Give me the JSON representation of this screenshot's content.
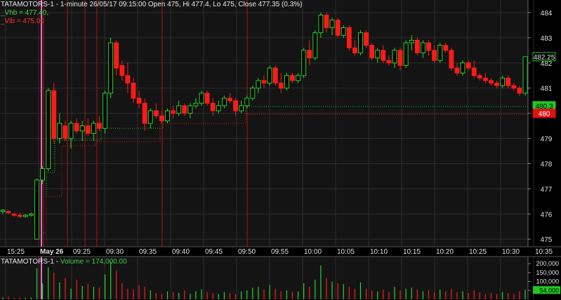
{
  "header": {
    "title": "TATAMOTORS-1 - 1-minute 26/05/17 09:15:00 Open 475, Hi 477.4, Lo 475, Close 477.35 (0.3%)",
    "vhb_label": "_Vhb = 477.40,",
    "vlb_label": "_Vlb = 475.00"
  },
  "volume_header": {
    "prefix": "TATAMOTORS-1 - ",
    "label": "Volume = 174,000.00"
  },
  "colors": {
    "up": "#29d429",
    "down": "#ff1a1a",
    "grid": "#2c2c2c",
    "text": "#e0e0e0",
    "pink": "#ff66cc"
  },
  "chart_data": [
    {
      "type": "candlestick",
      "title": "TATAMOTORS-1 - 1-minute",
      "ylim": [
        474.7,
        484.5
      ],
      "y_ticks": [
        475,
        476,
        477,
        478,
        479,
        480,
        481,
        482,
        483,
        484
      ],
      "x_labels": [
        "15:25",
        "May 26",
        "09:25",
        "09:30",
        "09:35",
        "09:40",
        "09:45",
        "09:50",
        "09:55",
        "10:00",
        "10:05",
        "10:10",
        "10:15",
        "10:20",
        "10:25",
        "10:30",
        "10:35"
      ],
      "price_markers": [
        {
          "value": 482.25,
          "label": "482.25",
          "color": "green"
        },
        {
          "value": 480.3,
          "label": "480.3",
          "color": "green"
        },
        {
          "value": 480.0,
          "label": "480",
          "color": "red"
        }
      ],
      "candles": [
        {
          "o": 476.1,
          "h": 476.2,
          "l": 476.0,
          "c": 476.15
        },
        {
          "o": 476.1,
          "h": 476.15,
          "l": 476.0,
          "c": 476.05
        },
        {
          "o": 476.0,
          "h": 476.05,
          "l": 475.9,
          "c": 475.95
        },
        {
          "o": 475.95,
          "h": 476.05,
          "l": 475.85,
          "c": 475.9
        },
        {
          "o": 475.9,
          "h": 476.0,
          "l": 475.85,
          "c": 475.95
        },
        {
          "o": 475.95,
          "h": 476.05,
          "l": 475.9,
          "c": 476.0
        },
        {
          "o": 475.0,
          "h": 477.4,
          "l": 475.0,
          "c": 477.35
        },
        {
          "o": 477.35,
          "h": 477.9,
          "l": 477.2,
          "c": 477.8
        },
        {
          "o": 477.8,
          "h": 481.0,
          "l": 477.7,
          "c": 480.9
        },
        {
          "o": 480.9,
          "h": 481.2,
          "l": 478.8,
          "c": 479.0
        },
        {
          "o": 479.0,
          "h": 480.0,
          "l": 478.8,
          "c": 479.6
        },
        {
          "o": 479.5,
          "h": 479.7,
          "l": 478.9,
          "c": 479.0
        },
        {
          "o": 479.0,
          "h": 479.7,
          "l": 478.6,
          "c": 479.6
        },
        {
          "o": 479.6,
          "h": 479.8,
          "l": 479.2,
          "c": 479.3
        },
        {
          "o": 479.3,
          "h": 479.7,
          "l": 478.9,
          "c": 479.5
        },
        {
          "o": 479.5,
          "h": 479.8,
          "l": 479.1,
          "c": 479.2
        },
        {
          "o": 479.2,
          "h": 479.7,
          "l": 478.9,
          "c": 479.6
        },
        {
          "o": 479.6,
          "h": 479.9,
          "l": 479.3,
          "c": 479.4
        },
        {
          "o": 479.4,
          "h": 480.9,
          "l": 479.2,
          "c": 480.8
        },
        {
          "o": 480.8,
          "h": 483.0,
          "l": 480.6,
          "c": 482.8
        },
        {
          "o": 482.8,
          "h": 482.9,
          "l": 481.5,
          "c": 481.8
        },
        {
          "o": 481.9,
          "h": 482.1,
          "l": 481.3,
          "c": 481.5
        },
        {
          "o": 481.5,
          "h": 482.0,
          "l": 480.8,
          "c": 481.2
        },
        {
          "o": 481.2,
          "h": 481.4,
          "l": 480.4,
          "c": 480.6
        },
        {
          "o": 480.6,
          "h": 480.9,
          "l": 480.2,
          "c": 480.4
        },
        {
          "o": 480.4,
          "h": 480.6,
          "l": 479.3,
          "c": 479.6
        },
        {
          "o": 479.6,
          "h": 480.2,
          "l": 479.4,
          "c": 480.1
        },
        {
          "o": 480.1,
          "h": 480.4,
          "l": 479.8,
          "c": 479.9
        },
        {
          "o": 479.9,
          "h": 480.1,
          "l": 479.6,
          "c": 479.7
        },
        {
          "o": 479.7,
          "h": 480.2,
          "l": 479.6,
          "c": 480.1
        },
        {
          "o": 480.1,
          "h": 480.3,
          "l": 479.8,
          "c": 480.0
        },
        {
          "o": 480.0,
          "h": 480.5,
          "l": 479.9,
          "c": 480.3
        },
        {
          "o": 480.3,
          "h": 480.4,
          "l": 479.9,
          "c": 480.0
        },
        {
          "o": 480.0,
          "h": 480.4,
          "l": 479.8,
          "c": 480.3
        },
        {
          "o": 480.3,
          "h": 480.6,
          "l": 480.2,
          "c": 480.4
        },
        {
          "o": 480.4,
          "h": 480.9,
          "l": 480.3,
          "c": 480.8
        },
        {
          "o": 480.8,
          "h": 480.9,
          "l": 480.3,
          "c": 480.4
        },
        {
          "o": 480.4,
          "h": 480.6,
          "l": 479.9,
          "c": 480.1
        },
        {
          "o": 480.1,
          "h": 480.5,
          "l": 480.0,
          "c": 480.3
        },
        {
          "o": 480.3,
          "h": 480.7,
          "l": 480.2,
          "c": 480.6
        },
        {
          "o": 480.6,
          "h": 480.8,
          "l": 480.4,
          "c": 480.5
        },
        {
          "o": 480.5,
          "h": 480.6,
          "l": 479.9,
          "c": 480.1
        },
        {
          "o": 480.1,
          "h": 480.5,
          "l": 480.0,
          "c": 480.3
        },
        {
          "o": 480.3,
          "h": 480.7,
          "l": 480.2,
          "c": 480.6
        },
        {
          "o": 480.6,
          "h": 481.1,
          "l": 480.5,
          "c": 481.0
        },
        {
          "o": 481.0,
          "h": 481.4,
          "l": 480.8,
          "c": 481.3
        },
        {
          "o": 481.3,
          "h": 481.5,
          "l": 481.0,
          "c": 481.2
        },
        {
          "o": 481.2,
          "h": 481.9,
          "l": 481.1,
          "c": 481.8
        },
        {
          "o": 481.8,
          "h": 481.9,
          "l": 481.1,
          "c": 481.2
        },
        {
          "o": 481.2,
          "h": 481.6,
          "l": 480.8,
          "c": 481.0
        },
        {
          "o": 481.0,
          "h": 481.6,
          "l": 480.9,
          "c": 481.5
        },
        {
          "o": 481.5,
          "h": 481.6,
          "l": 481.2,
          "c": 481.3
        },
        {
          "o": 481.3,
          "h": 481.6,
          "l": 481.2,
          "c": 481.5
        },
        {
          "o": 481.5,
          "h": 482.6,
          "l": 481.4,
          "c": 482.5
        },
        {
          "o": 482.5,
          "h": 482.9,
          "l": 481.9,
          "c": 482.2
        },
        {
          "o": 482.2,
          "h": 483.3,
          "l": 482.1,
          "c": 483.2
        },
        {
          "o": 483.2,
          "h": 484.0,
          "l": 483.0,
          "c": 483.9
        },
        {
          "o": 483.9,
          "h": 484.0,
          "l": 483.2,
          "c": 483.4
        },
        {
          "o": 483.4,
          "h": 483.8,
          "l": 483.1,
          "c": 483.7
        },
        {
          "o": 483.7,
          "h": 483.8,
          "l": 483.0,
          "c": 483.1
        },
        {
          "o": 483.1,
          "h": 483.5,
          "l": 483.0,
          "c": 483.4
        },
        {
          "o": 483.4,
          "h": 483.5,
          "l": 482.5,
          "c": 482.6
        },
        {
          "o": 482.6,
          "h": 482.9,
          "l": 482.3,
          "c": 482.4
        },
        {
          "o": 482.4,
          "h": 483.3,
          "l": 482.3,
          "c": 483.2
        },
        {
          "o": 483.2,
          "h": 483.3,
          "l": 482.6,
          "c": 482.7
        },
        {
          "o": 482.7,
          "h": 482.8,
          "l": 482.1,
          "c": 482.2
        },
        {
          "o": 482.2,
          "h": 482.6,
          "l": 482.0,
          "c": 482.5
        },
        {
          "o": 482.5,
          "h": 482.7,
          "l": 482.0,
          "c": 482.1
        },
        {
          "o": 482.1,
          "h": 482.3,
          "l": 481.9,
          "c": 482.0
        },
        {
          "o": 482.0,
          "h": 482.6,
          "l": 481.8,
          "c": 482.5
        },
        {
          "o": 482.5,
          "h": 482.6,
          "l": 481.7,
          "c": 481.9
        },
        {
          "o": 481.9,
          "h": 482.9,
          "l": 481.8,
          "c": 482.8
        },
        {
          "o": 482.8,
          "h": 483.1,
          "l": 482.5,
          "c": 482.9
        },
        {
          "o": 482.9,
          "h": 483.0,
          "l": 482.3,
          "c": 482.4
        },
        {
          "o": 482.4,
          "h": 482.9,
          "l": 482.2,
          "c": 482.8
        },
        {
          "o": 482.8,
          "h": 482.9,
          "l": 482.3,
          "c": 482.5
        },
        {
          "o": 482.5,
          "h": 482.7,
          "l": 482.0,
          "c": 482.1
        },
        {
          "o": 482.1,
          "h": 482.8,
          "l": 482.0,
          "c": 482.7
        },
        {
          "o": 482.7,
          "h": 482.8,
          "l": 482.4,
          "c": 482.5
        },
        {
          "o": 482.5,
          "h": 482.6,
          "l": 481.7,
          "c": 481.8
        },
        {
          "o": 481.8,
          "h": 482.0,
          "l": 481.5,
          "c": 481.6
        },
        {
          "o": 481.6,
          "h": 482.1,
          "l": 481.5,
          "c": 482.0
        },
        {
          "o": 482.0,
          "h": 482.1,
          "l": 481.7,
          "c": 481.8
        },
        {
          "o": 481.8,
          "h": 482.1,
          "l": 481.4,
          "c": 481.5
        },
        {
          "o": 481.5,
          "h": 481.6,
          "l": 481.3,
          "c": 481.4
        },
        {
          "o": 481.4,
          "h": 481.6,
          "l": 481.2,
          "c": 481.3
        },
        {
          "o": 481.3,
          "h": 481.4,
          "l": 481.1,
          "c": 481.2
        },
        {
          "o": 481.2,
          "h": 481.3,
          "l": 481.0,
          "c": 481.1
        },
        {
          "o": 481.1,
          "h": 481.5,
          "l": 481.0,
          "c": 481.4
        },
        {
          "o": 481.4,
          "h": 481.5,
          "l": 481.0,
          "c": 481.1
        },
        {
          "o": 481.1,
          "h": 481.2,
          "l": 480.9,
          "c": 481.0
        },
        {
          "o": 481.0,
          "h": 481.1,
          "l": 480.7,
          "c": 480.8
        },
        {
          "o": 480.8,
          "h": 482.25,
          "l": 480.7,
          "c": 482.25
        }
      ]
    },
    {
      "type": "bar",
      "title": "Volume",
      "y_ticks": [
        50000,
        100000,
        150000,
        200000
      ],
      "y_tick_labels": [
        "50,000",
        "100,000",
        "150,000",
        "200,000"
      ],
      "last_value_label": "54,000",
      "ylim": [
        0,
        240000
      ],
      "values": [
        12000,
        15000,
        9000,
        11000,
        8000,
        10000,
        174000,
        90000,
        180000,
        150000,
        95000,
        120000,
        60000,
        110000,
        75000,
        85000,
        70000,
        65000,
        140000,
        210000,
        160000,
        90000,
        60000,
        55000,
        80000,
        70000,
        50000,
        35000,
        30000,
        45000,
        40000,
        35000,
        50000,
        30000,
        45000,
        55000,
        40000,
        35000,
        30000,
        40000,
        35000,
        30000,
        45000,
        50000,
        65000,
        70000,
        55000,
        80000,
        60000,
        45000,
        50000,
        40000,
        45000,
        90000,
        70000,
        110000,
        190000,
        120000,
        100000,
        90000,
        85000,
        70000,
        60000,
        95000,
        60000,
        50000,
        45000,
        55000,
        40000,
        70000,
        50000,
        60000,
        65000,
        55000,
        45000,
        50000,
        40000,
        55000,
        45000,
        60000,
        40000,
        45000,
        35000,
        50000,
        40000,
        30000,
        35000,
        30000,
        40000,
        35000,
        30000,
        45000,
        54000
      ],
      "up_flags": [
        1,
        0,
        0,
        0,
        1,
        1,
        1,
        1,
        1,
        0,
        1,
        0,
        1,
        0,
        1,
        0,
        1,
        0,
        1,
        1,
        0,
        0,
        0,
        0,
        0,
        0,
        1,
        0,
        0,
        1,
        0,
        1,
        0,
        1,
        1,
        1,
        0,
        0,
        1,
        1,
        0,
        0,
        1,
        1,
        1,
        1,
        0,
        1,
        0,
        0,
        1,
        0,
        1,
        1,
        0,
        1,
        1,
        0,
        1,
        0,
        1,
        0,
        0,
        1,
        0,
        0,
        1,
        0,
        0,
        1,
        0,
        1,
        1,
        0,
        1,
        0,
        0,
        1,
        0,
        0,
        0,
        1,
        0,
        0,
        0,
        0,
        0,
        0,
        1,
        0,
        0,
        0,
        1
      ]
    }
  ]
}
